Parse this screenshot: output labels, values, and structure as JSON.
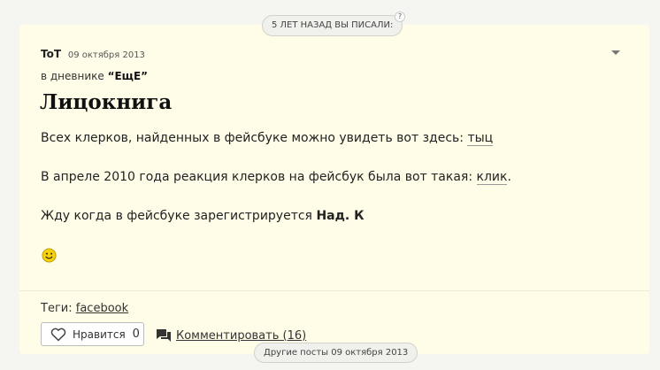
{
  "header": {
    "years_ago_label": "5 ЛЕТ НАЗАД ВЫ ПИСАЛИ:",
    "help_label": "?"
  },
  "post": {
    "author": "ToT",
    "date": "09 октября 2013",
    "diary_prefix": "в дневнике",
    "diary_name": "“ЕщЕ”",
    "title": "Лицокнига",
    "paragraph1_text": "Всех клерков, найденных в фейсбуке можно увидеть вот здесь: ",
    "paragraph1_link": "тыц",
    "paragraph2_text": "В  апреле 2010 года реакция клерков на фейсбук была вот такая: ",
    "paragraph2_link": "клик",
    "paragraph2_end": ".",
    "paragraph3_text": "Жду когда в фейсбуке зарегистрируется ",
    "paragraph3_bold": "Над. К",
    "smiley_icon": "smiley-face"
  },
  "footer": {
    "tags_label": "Теги:",
    "tag": "facebook",
    "like_label": "Нравится",
    "like_count": "0",
    "comment_label": "Комментировать (16)",
    "other_posts_label": "Другие посты 09 октября 2013"
  },
  "colors": {
    "card_bg": "#fffde8",
    "page_bg": "#f5f5f2"
  }
}
